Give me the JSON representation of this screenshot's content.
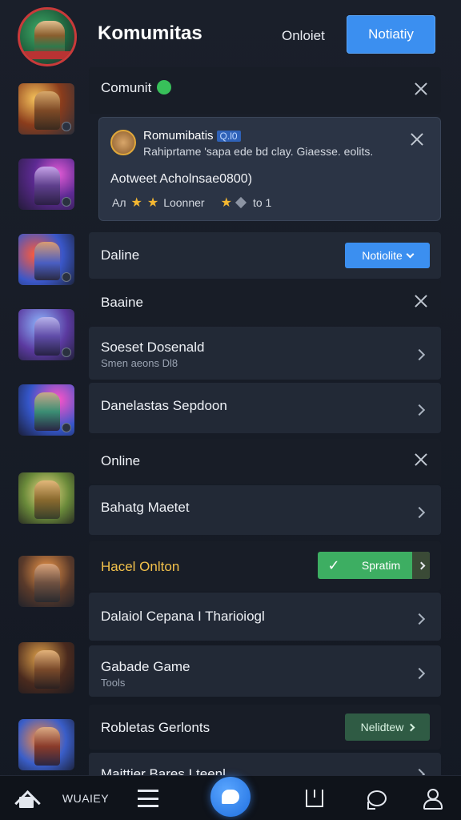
{
  "header": {
    "title": "Komumitas",
    "online_label": "Onloiet",
    "action_button": "Notiatiy"
  },
  "rows": {
    "community": {
      "label": "Comunit",
      "emoji_icon": "green-frog-emoji"
    },
    "card": {
      "name": "Romumibatis",
      "tag": "Q.l0",
      "description": "Rahiprtame 'sapa ede bd clay. Giaesse. eolits.",
      "achievement": "Aotweet Acholnsae0800)",
      "stat_a": "Ал",
      "stat_b": "Loonner",
      "stat_c": "to 1"
    },
    "daline": {
      "label": "Daline",
      "button": "Notiolite"
    },
    "baine": {
      "label": "Baaine"
    },
    "soeset": {
      "label": "Soeset Dosenald",
      "sub": "Smen aeons Dl8"
    },
    "danelastas": {
      "label": "Danelastas Sepdoon"
    },
    "online": {
      "label": "Online"
    },
    "bahato": {
      "label": "Bahatg Maetet"
    },
    "hacel": {
      "label": "Hacel Onlton",
      "button": "Spratim"
    },
    "dalaiol": {
      "label": "Dalaiol Cepana I Tharioiogl"
    },
    "gabade": {
      "label": "Gabade Game",
      "sub": "Tools"
    },
    "robletas": {
      "label": "Robletas Gerlonts",
      "button": "Nelidtew"
    },
    "maitter": {
      "label": "Maittier Bares Lteenl"
    }
  },
  "bottom_nav": {
    "home": "home-icon",
    "text_item": "WUAIEY",
    "menu": "menu-icon",
    "center": "chat-bubble-icon",
    "book": "book-icon",
    "messages": "message-icon",
    "profile": "profile-icon"
  },
  "colors": {
    "accent_blue": "#3b8ff0",
    "accent_green": "#3dae62",
    "highlight_text": "#f2c14b"
  }
}
